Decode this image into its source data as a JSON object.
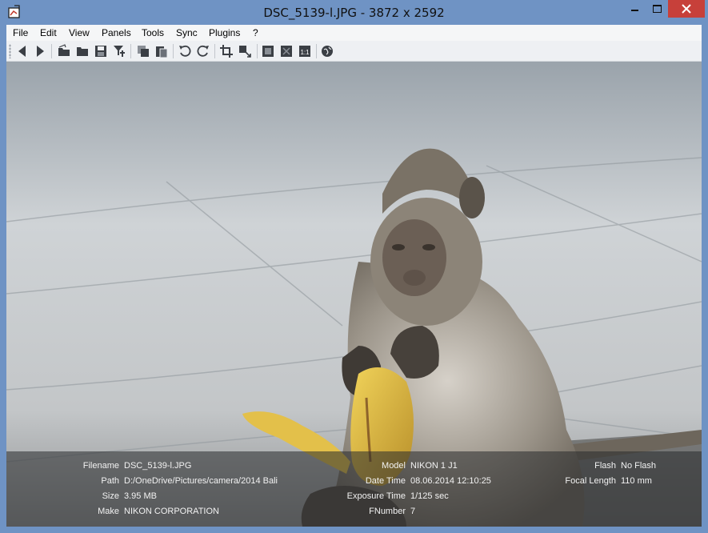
{
  "window": {
    "title": "DSC_5139-l.JPG  - 3872 x 2592"
  },
  "menu": [
    {
      "label": "File"
    },
    {
      "label": "Edit"
    },
    {
      "label": "View"
    },
    {
      "label": "Panels"
    },
    {
      "label": "Tools"
    },
    {
      "label": "Sync"
    },
    {
      "label": "Plugins"
    },
    {
      "label": "?"
    }
  ],
  "toolbar": {
    "icons": [
      "back-icon",
      "forward-icon",
      "open-file-icon",
      "open-folder-icon",
      "save-icon",
      "save-as-icon",
      "copy-icon",
      "paste-icon",
      "rotate-left-icon",
      "rotate-right-icon",
      "crop-icon",
      "resize-icon",
      "fit-window-icon",
      "fullscreen-icon",
      "actual-size-icon",
      "web-icon"
    ],
    "actual_size_label": "1:1"
  },
  "exif": {
    "col1": [
      {
        "key": "Filename",
        "value": "DSC_5139-l.JPG"
      },
      {
        "key": "Path",
        "value": "D:/OneDrive/Pictures/camera/2014 Bali"
      },
      {
        "key": "Size",
        "value": "3.95 MB"
      },
      {
        "key": "Make",
        "value": "NIKON CORPORATION"
      }
    ],
    "col2": [
      {
        "key": "Model",
        "value": "NIKON 1 J1"
      },
      {
        "key": "Date Time",
        "value": "08.06.2014 12:10:25"
      },
      {
        "key": "Exposure Time",
        "value": "1/125 sec"
      },
      {
        "key": "FNumber",
        "value": "7"
      }
    ],
    "col3": [
      {
        "key": "Flash",
        "value": "No Flash"
      },
      {
        "key": "Focal Length",
        "value": "110 mm"
      }
    ]
  },
  "colors": {
    "titlebar": "#6f93c4",
    "close_button": "#c7403a",
    "banana": "#e3c04a",
    "fur": "#8c8478"
  }
}
